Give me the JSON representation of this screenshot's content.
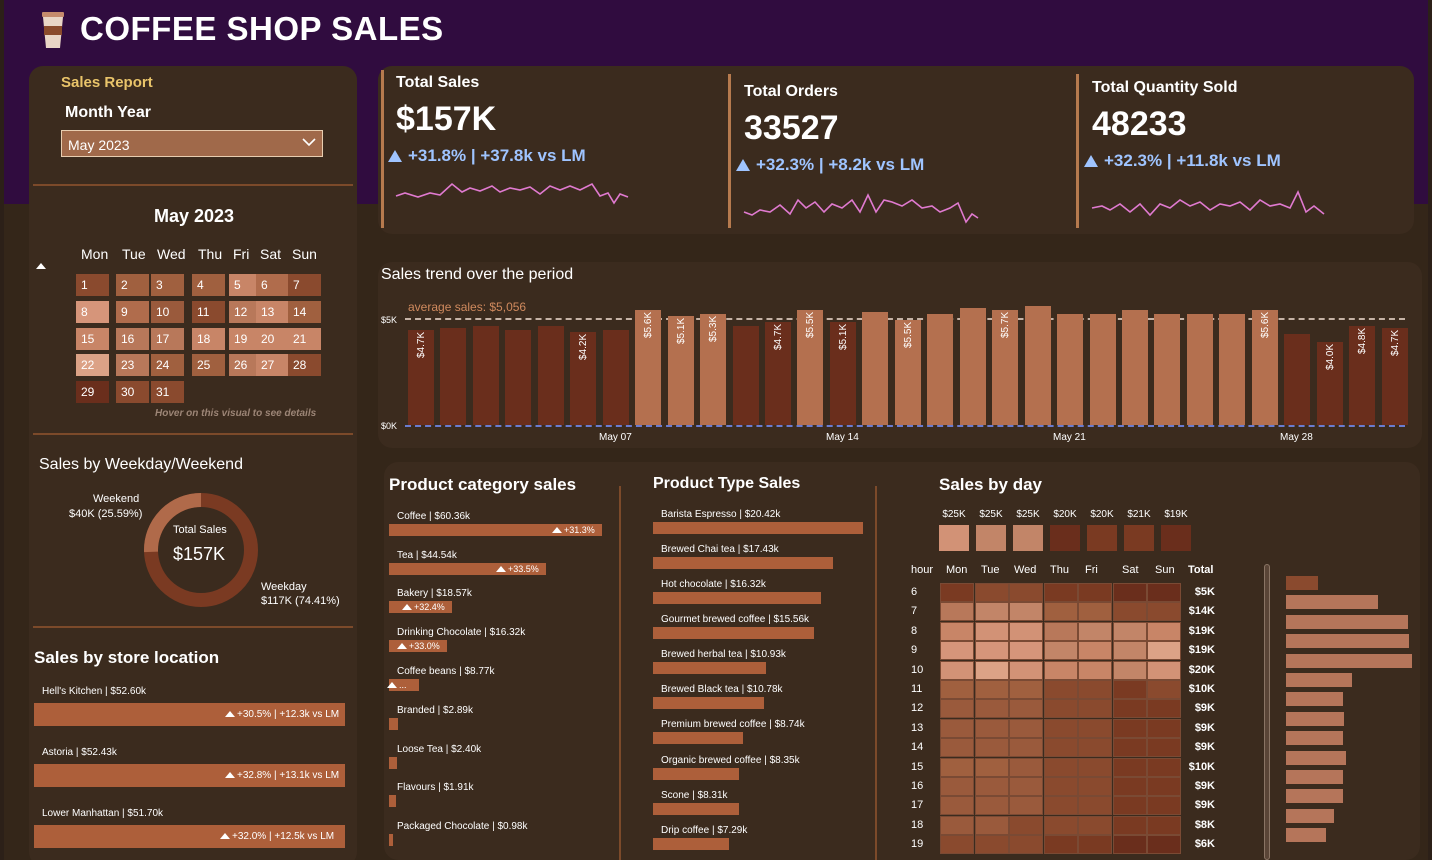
{
  "header": {
    "title": "COFFEE SHOP SALES",
    "icon": "coffee-cup-icon"
  },
  "slicer": {
    "heading": "Sales Report",
    "month_year_label": "Month Year",
    "month_selected": "May 2023",
    "calendar_title": "May 2023",
    "days_of_week": [
      "Mon",
      "Tue",
      "Wed",
      "Thu",
      "Fri",
      "Sat",
      "Sun"
    ],
    "hover_note": "Hover on this visual to see details"
  },
  "kpis": [
    {
      "title": "Total Sales",
      "value": "$157K",
      "delta": "+31.8% | +37.8k vs LM"
    },
    {
      "title": "Total Orders",
      "value": "33527",
      "delta": "+32.3% | +8.2k vs LM"
    },
    {
      "title": "Total Quantity Sold",
      "value": "48233",
      "delta": "+32.3% | +11.8k vs LM"
    }
  ],
  "weekday": {
    "title": "Sales by Weekday/Weekend",
    "center_label": "Total Sales",
    "center_value": "$157K",
    "weekend_label": "Weekend",
    "weekend_value": "$40K (25.59%)",
    "weekday_label": "Weekday",
    "weekday_value": "$117K (74.41%)",
    "weekend_fraction": 0.2559
  },
  "stores": {
    "title": "Sales by store location",
    "items": [
      {
        "label": "Hell's Kitchen | $52.60k",
        "delta": "+30.5% | +12.3k vs LM"
      },
      {
        "label": "Astoria | $52.43k",
        "delta": "+32.8% | +13.1k vs LM"
      },
      {
        "label": "Lower Manhattan | $51.70k",
        "delta": "+32.0% | +12.5k vs LM"
      }
    ]
  },
  "trend": {
    "title": "Sales trend over the period",
    "avg_label": "average sales: $5,056",
    "y_top": "$5K",
    "y_bottom": "$0K",
    "x_labels": [
      "May 07",
      "May 14",
      "May 21",
      "May 28"
    ]
  },
  "categories": {
    "title": "Product category sales",
    "items": [
      {
        "label": "Coffee | $60.36k",
        "delta": "+31.3%"
      },
      {
        "label": "Tea | $44.54k",
        "delta": "+33.5%"
      },
      {
        "label": "Bakery | $18.57k",
        "delta": "+32.4%"
      },
      {
        "label": "Drinking Chocolate | $16.32k",
        "delta": "+33.0%"
      },
      {
        "label": "Coffee beans | $8.77k",
        "delta": "..."
      },
      {
        "label": "Branded | $2.89k",
        "delta": ""
      },
      {
        "label": "Loose Tea | $2.40k",
        "delta": ""
      },
      {
        "label": "Flavours | $1.91k",
        "delta": ""
      },
      {
        "label": "Packaged Chocolate | $0.98k",
        "delta": ""
      }
    ]
  },
  "types": {
    "title": "Product Type Sales",
    "items": [
      {
        "label": "Barista Espresso | $20.42k"
      },
      {
        "label": "Brewed Chai tea | $17.43k"
      },
      {
        "label": "Hot chocolate | $16.32k"
      },
      {
        "label": "Gourmet brewed coffee | $15.56k"
      },
      {
        "label": "Brewed herbal tea | $10.93k"
      },
      {
        "label": "Brewed Black tea | $10.78k"
      },
      {
        "label": "Premium brewed coffee | $8.74k"
      },
      {
        "label": "Organic brewed coffee | $8.35k"
      },
      {
        "label": "Scone | $8.31k"
      },
      {
        "label": "Drip coffee | $7.29k"
      }
    ]
  },
  "byday": {
    "title": "Sales by day",
    "day_totals": [
      "$25K",
      "$25K",
      "$25K",
      "$20K",
      "$20K",
      "$21K",
      "$19K"
    ],
    "hour_header": "hour",
    "total_header": "Total",
    "days": [
      "Mon",
      "Tue",
      "Wed",
      "Thu",
      "Fri",
      "Sat",
      "Sun"
    ],
    "hours": [
      "6",
      "7",
      "8",
      "9",
      "10",
      "11",
      "12",
      "13",
      "14",
      "15",
      "16",
      "17",
      "18",
      "19"
    ],
    "hour_totals": [
      "$5K",
      "$14K",
      "$19K",
      "$19K",
      "$20K",
      "$10K",
      "$9K",
      "$9K",
      "$9K",
      "$10K",
      "$9K",
      "$9K",
      "$8K",
      "$6K"
    ]
  },
  "colors": {
    "accent": "#a05a3a",
    "light": "#d79a78",
    "dark": "#5e2a1a",
    "delta": "#9fc4ff",
    "header": "#300c3f"
  }
}
